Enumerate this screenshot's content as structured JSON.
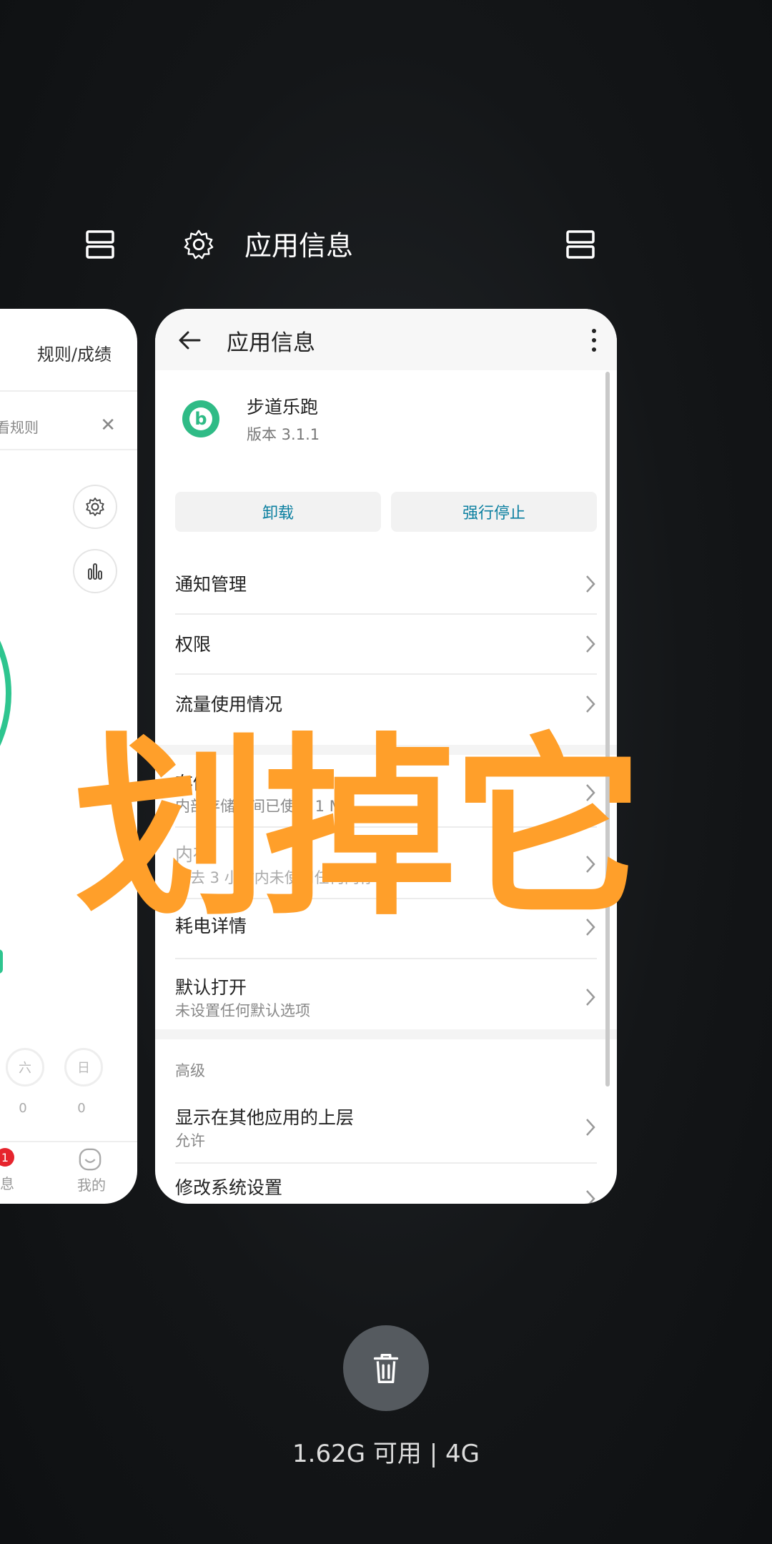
{
  "recents_header": {
    "title": "应用信息"
  },
  "left_card": {
    "top_link": "规则/成绩",
    "rule_text": "看规则",
    "week_days": [
      "六",
      "日"
    ],
    "day_values": [
      "0",
      "0"
    ],
    "tab_partial": "息",
    "tab_mine": "我的",
    "badge_count": "1"
  },
  "app_info": {
    "title": "应用信息",
    "app_name": "步道乐跑",
    "version": "版本 3.1.1",
    "app_icon_letter": "b",
    "buttons": {
      "uninstall": "卸载",
      "force_stop": "强行停止"
    },
    "rows": [
      {
        "title": "通知管理"
      },
      {
        "title": "权限"
      },
      {
        "title": "流量使用情况"
      },
      {
        "title": "存储",
        "sub": "内部存储空间已使用 1 MB"
      },
      {
        "title": "内存",
        "sub": "过去 3 小时内未使用任何内存"
      },
      {
        "title": "耗电详情"
      },
      {
        "title": "默认打开",
        "sub": "未设置任何默认选项"
      }
    ],
    "section_advanced": "高级",
    "advanced_rows": [
      {
        "title": "显示在其他应用的上层",
        "sub": "允许"
      },
      {
        "title": "修改系统设置"
      }
    ]
  },
  "overlay": {
    "text": "划掉它"
  },
  "memory_status": "1.62G 可用 | 4G",
  "colors": {
    "accent_orange": "#ff9f2a",
    "teal_button": "#0a7fa0",
    "app_green": "#2fbb86"
  }
}
